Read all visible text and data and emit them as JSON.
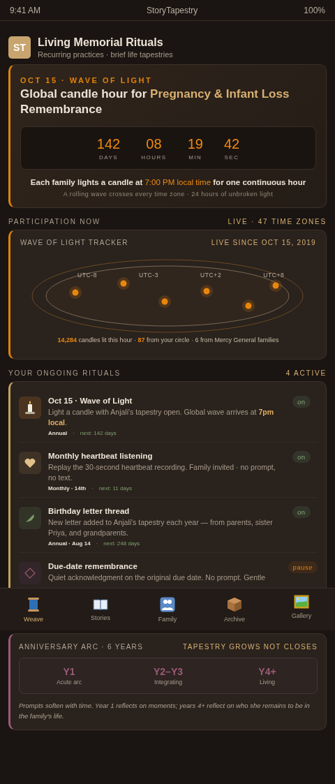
{
  "status_bar": {
    "time": "9:41 AM",
    "app": "StoryTapestry",
    "battery": "100%"
  },
  "header": {
    "logo": "ST",
    "title": "Living Memorial Rituals",
    "subtitle": "Recurring practices · brief life tapestries"
  },
  "hero": {
    "eyebrow": "OCT 15 · WAVE OF LIGHT",
    "title": [
      {
        "text": "Global candle hour for ",
        "accent": false
      },
      {
        "text": "Pregnancy & Infant Loss",
        "accent": true
      },
      {
        "text": " Remembrance",
        "accent": false
      }
    ],
    "countdown": [
      {
        "value": "142",
        "label": "DAYS"
      },
      {
        "value": "08",
        "label": "HOURS"
      },
      {
        "value": "19",
        "label": "MIN"
      },
      {
        "value": "42",
        "label": "SEC"
      }
    ],
    "note": [
      {
        "text": "Each family lights a candle at ",
        "accent": false
      },
      {
        "text": "7:00 PM local time",
        "accent": true
      },
      {
        "text": " for one continuous hour",
        "accent": false
      }
    ],
    "subnote": "A rolling wave crosses every time zone · 24 hours of unbroken light"
  },
  "participation": {
    "label": "PARTICIPATION NOW",
    "meta": "LIVE · 47 TIME ZONES",
    "tracker": {
      "title": "WAVE OF LIGHT TRACKER",
      "since": "LIVE SINCE OCT 15, 2019",
      "zones": [
        "UTC-8",
        "UTC-3",
        "UTC+2",
        "UTC+8"
      ],
      "stats": [
        {
          "text": "14,284",
          "accent": true
        },
        {
          "text": " candles lit this hour · ",
          "accent": false
        },
        {
          "text": "87",
          "accent": true
        },
        {
          "text": " from your circle · 6 from Mercy General families",
          "accent": false
        }
      ]
    }
  },
  "rituals": {
    "label": "YOUR ONGOING RITUALS",
    "meta": "4 ACTIVE",
    "items": [
      {
        "kind": "candle",
        "title": "Oct 15 · Wave of Light",
        "description": [
          {
            "text": "Light a candle with Anjali's tapestry open. Global wave arrives at ",
            "accent": false
          },
          {
            "text": "7pm local",
            "accent": true
          },
          {
            "text": ".",
            "accent": false
          }
        ],
        "schedule": "Annual",
        "separator": "·",
        "next": "next: 142 days",
        "status": "on",
        "paused": false
      },
      {
        "kind": "heart",
        "title": "Monthly heartbeat listening",
        "description": [
          {
            "text": "Replay the 30-second heartbeat recording. Family invited · no prompt, no text.",
            "accent": false
          }
        ],
        "schedule": "Monthly · 14th",
        "separator": "·",
        "next": "next: 11 days",
        "status": "on",
        "paused": false
      },
      {
        "kind": "quill",
        "title": "Birthday letter thread",
        "description": [
          {
            "text": "New letter added to Anjali's tapestry each year — from parents, sister Priya, and grandparents.",
            "accent": false
          }
        ],
        "schedule": "Annual · Aug 14",
        "separator": "·",
        "next": "next: 248 days",
        "status": "on",
        "paused": false
      },
      {
        "kind": "diamond",
        "title": "Due-date remembrance",
        "description": [
          {
            "text": "Quiet acknowledgment on the original due date. No prompt. Gentle",
            "accent": false
          }
        ],
        "status": "pause",
        "paused": true
      }
    ]
  },
  "tabs": [
    {
      "kind": "spool",
      "label": "Weave",
      "selected": true
    },
    {
      "kind": "book",
      "label": "Stories",
      "selected": false
    },
    {
      "kind": "people",
      "label": "Family",
      "selected": false
    },
    {
      "kind": "box",
      "label": "Archive",
      "selected": false
    },
    {
      "kind": "frame",
      "label": "Gallery",
      "selected": false
    }
  ],
  "anniversary": {
    "label": "ANNIVERSARY ARC · 6 YEARS",
    "meta": "TAPESTRY GROWS NOT CLOSES",
    "phases": [
      {
        "name": "Y1",
        "caption": "Acute arc"
      },
      {
        "name": "Y2–Y3",
        "caption": "Integrating"
      },
      {
        "name": "Y4+",
        "caption": "Living"
      }
    ],
    "note": "Prompts soften with time. Year 1 reflects on moments; years 4+ reflect on who she remains to be in the family's life."
  }
}
